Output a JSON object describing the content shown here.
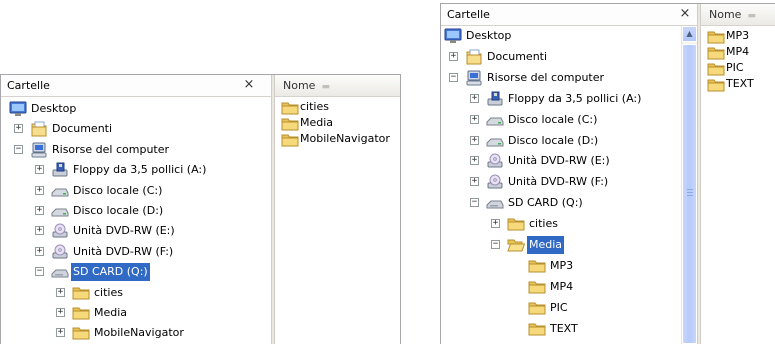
{
  "left_window": {
    "pane_title": "Cartelle",
    "close_glyph": "×",
    "column_header": "Nome",
    "tree": [
      {
        "label": "Desktop",
        "icon": "desktop-icon",
        "depth": 0,
        "expander": ""
      },
      {
        "label": "Documenti",
        "icon": "my-documents-icon",
        "depth": 1,
        "expander": "+"
      },
      {
        "label": "Risorse del computer",
        "icon": "my-computer-icon",
        "depth": 1,
        "expander": "−"
      },
      {
        "label": "Floppy da 3,5 pollici (A:)",
        "icon": "floppy-drive-icon",
        "depth": 2,
        "expander": "+"
      },
      {
        "label": "Disco locale (C:)",
        "icon": "hard-disk-icon",
        "depth": 2,
        "expander": "+"
      },
      {
        "label": "Disco locale (D:)",
        "icon": "hard-disk-icon",
        "depth": 2,
        "expander": "+"
      },
      {
        "label": "Unità DVD-RW (E:)",
        "icon": "dvd-drive-icon",
        "depth": 2,
        "expander": "+"
      },
      {
        "label": "Unità DVD-RW (F:)",
        "icon": "dvd-drive-icon",
        "depth": 2,
        "expander": "+"
      },
      {
        "label": "SD CARD (Q:)",
        "icon": "removable-disk-icon",
        "depth": 2,
        "expander": "−",
        "selected": true
      },
      {
        "label": "cities",
        "icon": "folder-icon",
        "depth": 3,
        "expander": "+"
      },
      {
        "label": "Media",
        "icon": "folder-icon",
        "depth": 3,
        "expander": "+"
      },
      {
        "label": "MobileNavigator",
        "icon": "folder-icon",
        "depth": 3,
        "expander": "+"
      }
    ],
    "files": [
      "cities",
      "Media",
      "MobileNavigator"
    ]
  },
  "right_window": {
    "pane_title": "Cartelle",
    "close_glyph": "×",
    "column_header": "Nome",
    "tree": [
      {
        "label": "Desktop",
        "icon": "desktop-icon",
        "depth": 0,
        "expander": ""
      },
      {
        "label": "Documenti",
        "icon": "my-documents-icon",
        "depth": 1,
        "expander": "+"
      },
      {
        "label": "Risorse del computer",
        "icon": "my-computer-icon",
        "depth": 1,
        "expander": "−"
      },
      {
        "label": "Floppy da 3,5 pollici (A:)",
        "icon": "floppy-drive-icon",
        "depth": 2,
        "expander": "+"
      },
      {
        "label": "Disco locale (C:)",
        "icon": "hard-disk-icon",
        "depth": 2,
        "expander": "+"
      },
      {
        "label": "Disco locale (D:)",
        "icon": "hard-disk-icon",
        "depth": 2,
        "expander": "+"
      },
      {
        "label": "Unità DVD-RW (E:)",
        "icon": "dvd-drive-icon",
        "depth": 2,
        "expander": "+"
      },
      {
        "label": "Unità DVD-RW (F:)",
        "icon": "dvd-drive-icon",
        "depth": 2,
        "expander": "+"
      },
      {
        "label": "SD CARD (Q:)",
        "icon": "removable-disk-icon",
        "depth": 2,
        "expander": "−"
      },
      {
        "label": "cities",
        "icon": "folder-icon",
        "depth": 3,
        "expander": "+"
      },
      {
        "label": "Media",
        "icon": "open-folder-icon",
        "depth": 3,
        "expander": "−",
        "selected": true
      },
      {
        "label": "MP3",
        "icon": "folder-icon",
        "depth": 4,
        "expander": ""
      },
      {
        "label": "MP4",
        "icon": "folder-icon",
        "depth": 4,
        "expander": ""
      },
      {
        "label": "PIC",
        "icon": "folder-icon",
        "depth": 4,
        "expander": ""
      },
      {
        "label": "TEXT",
        "icon": "folder-icon",
        "depth": 4,
        "expander": ""
      }
    ],
    "files": [
      "MP3",
      "MP4",
      "PIC",
      "TEXT"
    ]
  },
  "colors": {
    "selection": "#316ac5",
    "folder": "#f2d36b",
    "scrollbar": "#b7cbfa"
  }
}
